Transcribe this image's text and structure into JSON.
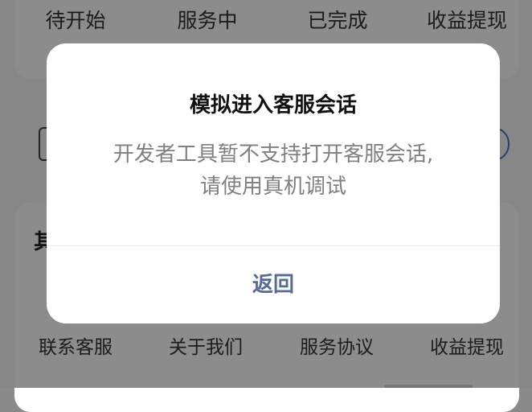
{
  "orders": {
    "tabs": [
      "待开始",
      "服务中",
      "已完成",
      "收益提现"
    ]
  },
  "tools": {
    "heading": "其",
    "items": [
      "联系客服",
      "关于我们",
      "服务协议",
      "收益提现"
    ]
  },
  "modal": {
    "title": "模拟进入客服会话",
    "content_line1": "开发者工具暂不支持打开客服会话,",
    "content_line2": "请使用真机调试",
    "confirm_label": "返回",
    "confirm_color": "#576b95"
  },
  "colors": {
    "accent": "#4a6fe0"
  }
}
